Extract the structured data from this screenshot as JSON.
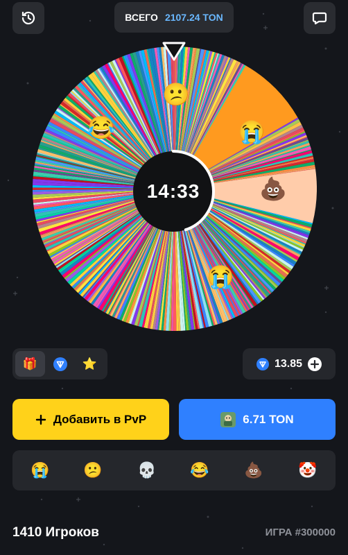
{
  "header": {
    "history_icon": "history-clock-icon",
    "chat_icon": "chat-bubble-icon",
    "total_label": "ВСЕГО",
    "total_value": "2107.24 TON"
  },
  "wheel": {
    "timer": "14:33",
    "timer_progress": 0.45,
    "emojis": [
      "😕",
      "😂",
      "😭",
      "💩",
      "😭"
    ]
  },
  "toggle": {
    "items": [
      "gift-icon",
      "ton-icon",
      "star-icon"
    ],
    "gift_glyph": "🎁",
    "star_glyph": "⭐",
    "active_index": 0
  },
  "balance": {
    "value": "13.85",
    "currency_icon": "ton-icon",
    "add_icon": "plus-circle-icon"
  },
  "actions": {
    "add_label": "Добавить в PvP",
    "bet_value": "6.71 TON"
  },
  "emoji_bar": [
    "😭",
    "😕",
    "💀",
    "😂",
    "💩",
    "🤡"
  ],
  "footer": {
    "players": "1410 Игроков",
    "game": "ИГРА #300000"
  },
  "colors": {
    "background": "#14161b",
    "panel": "#25272c",
    "yellow": "#ffd21a",
    "blue": "#2f80ff",
    "ton_blue": "#6ab8ff"
  }
}
